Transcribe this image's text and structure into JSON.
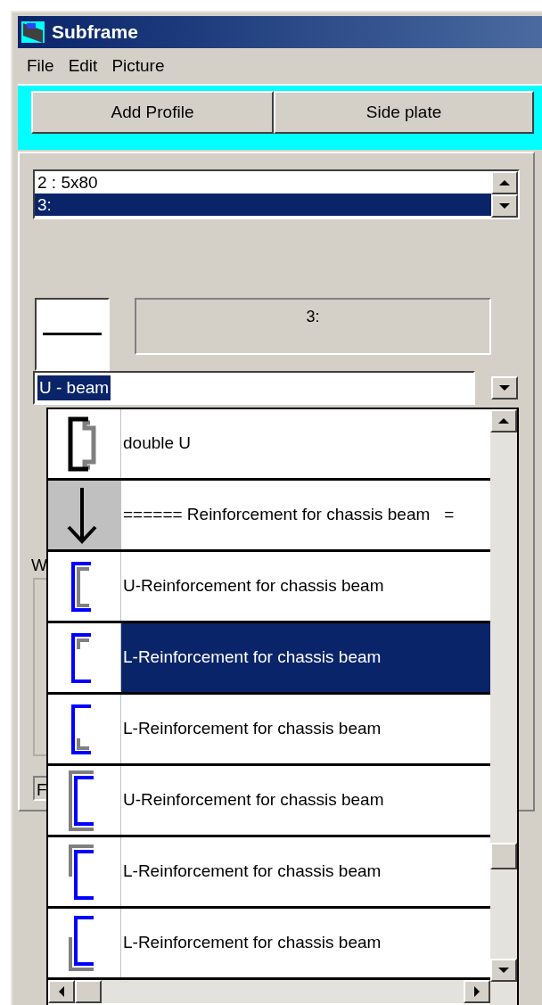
{
  "window": {
    "title": "Subframe"
  },
  "menu": [
    "File",
    "Edit",
    "Picture"
  ],
  "toolbar": {
    "buttons": [
      "Add Profile",
      "Side plate"
    ]
  },
  "profiles": {
    "items": [
      {
        "label": "2 : 5x80",
        "selected": false
      },
      {
        "label": "3:",
        "selected": true
      }
    ]
  },
  "preview": {
    "caption": "3:"
  },
  "combo": {
    "value": "U - beam"
  },
  "behind_labels": [
    "W",
    "F"
  ],
  "dropdown": {
    "items": [
      {
        "kind": "double-u",
        "label": "double U",
        "selected": false
      },
      {
        "kind": "arrow",
        "label": "====== Reinforcement for chassis beam   =",
        "selected": false
      },
      {
        "kind": "u-inner",
        "label": "U-Reinforcement for chassis beam",
        "selected": false
      },
      {
        "kind": "l-top",
        "label": "L-Reinforcement for chassis beam",
        "selected": true
      },
      {
        "kind": "l-bottom",
        "label": "L-Reinforcement for chassis beam",
        "selected": false
      },
      {
        "kind": "u-outer",
        "label": "U-Reinforcement for chassis beam",
        "selected": false
      },
      {
        "kind": "l-outer-top",
        "label": "L-Reinforcement for chassis beam",
        "selected": false
      },
      {
        "kind": "l-outer-bottom",
        "label": "L-Reinforcement for chassis beam",
        "selected": false
      }
    ]
  }
}
